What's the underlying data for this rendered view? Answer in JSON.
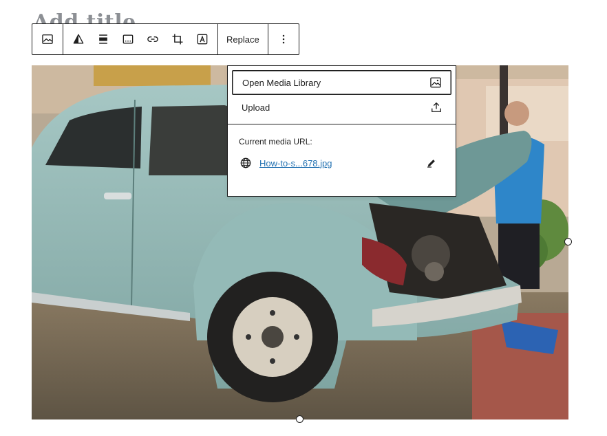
{
  "heading": {
    "text": "Add title"
  },
  "toolbar": {
    "replace_label": "Replace",
    "icons": [
      "image-icon",
      "duotone-icon",
      "align-icon",
      "caption-icon",
      "link-icon",
      "crop-icon",
      "text-overlay-icon",
      "more-options-icon"
    ]
  },
  "replace_menu": {
    "open_media_library_label": "Open Media Library",
    "upload_label": "Upload",
    "current_media_url_label": "Current media URL:",
    "current_media_url_text": "How-to-s...678.jpg"
  },
  "colors": {
    "border": "#1e1e1e",
    "link": "#2271b1",
    "car_body": "#8fb5b2"
  }
}
